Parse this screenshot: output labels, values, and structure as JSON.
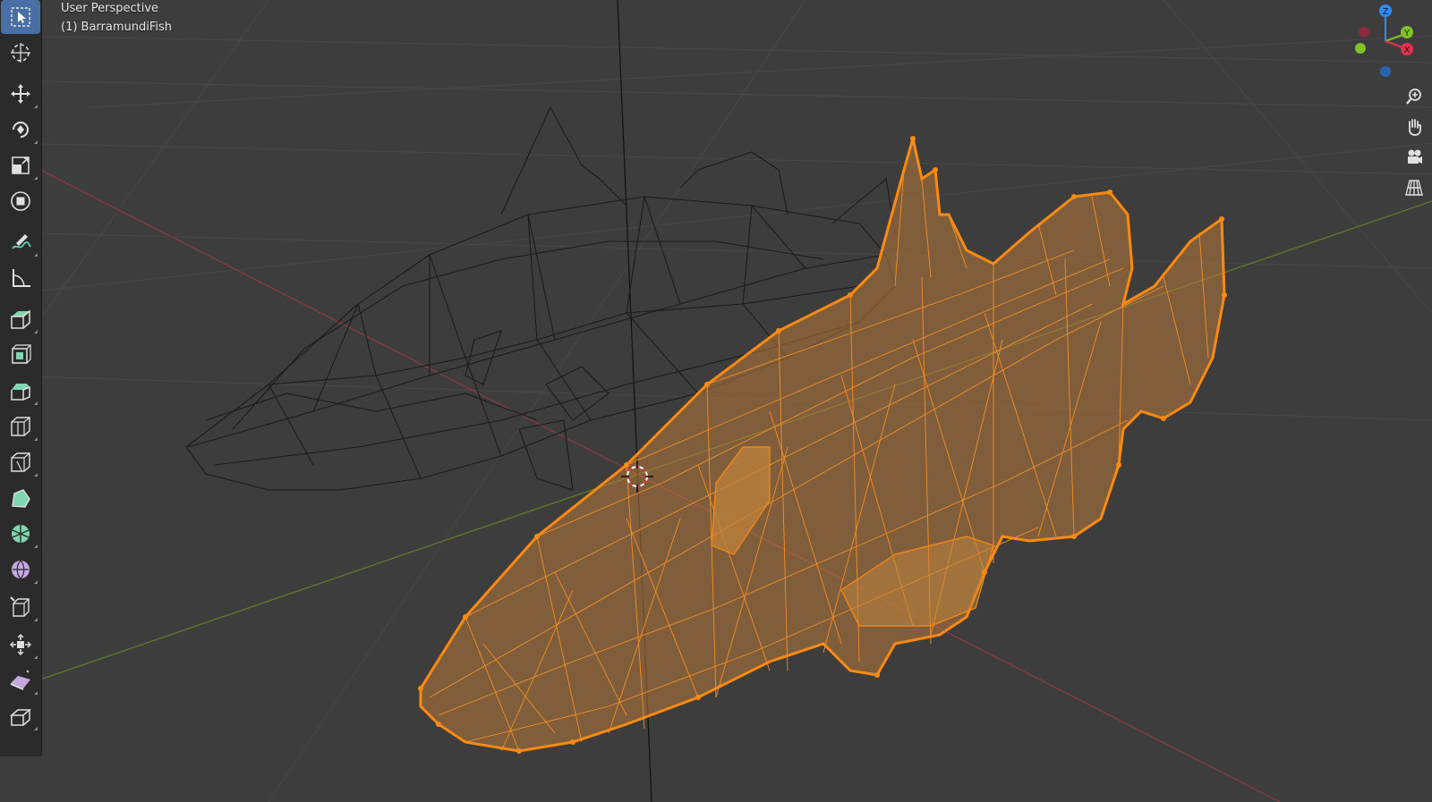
{
  "viewport": {
    "view_name": "User Perspective",
    "object_name": "(1) BarramundiFish",
    "selection_color": "#ff8c1a",
    "background_color": "#3d3d3d"
  },
  "gizmo": {
    "z_label": "Z",
    "y_label": "Y",
    "x_label": "X",
    "x_color": "#e0344c",
    "y_color": "#7fc22a",
    "z_color": "#2f8cf0"
  },
  "toolbar": {
    "tools": [
      {
        "icon": "select-box-icon",
        "active": true
      },
      {
        "icon": "cursor-icon"
      },
      {
        "icon": "move-icon"
      },
      {
        "icon": "rotate-icon"
      },
      {
        "icon": "scale-icon"
      },
      {
        "icon": "transform-icon"
      },
      {
        "icon": "annotate-icon"
      },
      {
        "icon": "measure-icon"
      },
      {
        "icon": "extrude-region-icon"
      },
      {
        "icon": "inset-faces-icon"
      },
      {
        "icon": "bevel-icon"
      },
      {
        "icon": "loop-cut-icon"
      },
      {
        "icon": "knife-icon"
      },
      {
        "icon": "poly-build-icon"
      },
      {
        "icon": "spin-icon"
      },
      {
        "icon": "smooth-icon"
      },
      {
        "icon": "edge-slide-icon"
      },
      {
        "icon": "shrink-fatten-icon"
      },
      {
        "icon": "shear-icon"
      },
      {
        "icon": "rip-region-icon"
      }
    ]
  },
  "navigation": {
    "buttons": [
      {
        "icon": "zoom-icon"
      },
      {
        "icon": "pan-hand-icon"
      },
      {
        "icon": "camera-icon"
      },
      {
        "icon": "perspective-grid-icon"
      }
    ]
  }
}
